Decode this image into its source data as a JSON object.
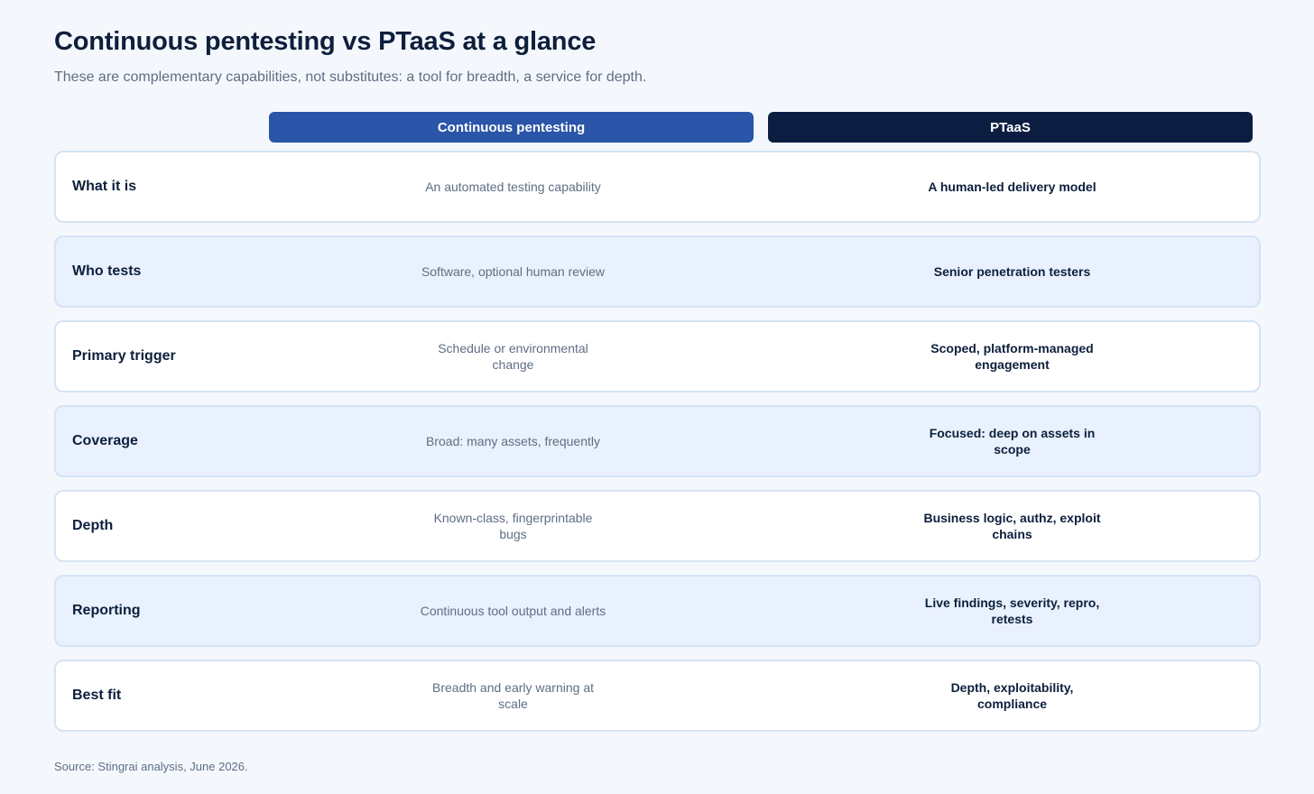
{
  "title": "Continuous pentesting vs PTaaS at a glance",
  "subtitle": "These are complementary capabilities, not substitutes: a tool for breadth, a service for depth.",
  "columns": {
    "continuous": "Continuous pentesting",
    "ptaas": "PTaaS"
  },
  "colors": {
    "continuous_header": "#2a55a8",
    "ptaas_header": "#0b1e42",
    "row_alt_background": "#e8f1fd",
    "page_background": "#f4f8fd"
  },
  "rows": [
    {
      "label": "What it is",
      "continuous": "An automated testing capability",
      "ptaas": "A human-led delivery model"
    },
    {
      "label": "Who tests",
      "continuous": "Software, optional human review",
      "ptaas": "Senior penetration testers"
    },
    {
      "label": "Primary trigger",
      "continuous": "Schedule or environmental change",
      "ptaas": "Scoped, platform-managed engagement"
    },
    {
      "label": "Coverage",
      "continuous": "Broad: many assets, frequently",
      "ptaas": "Focused: deep on assets in scope"
    },
    {
      "label": "Depth",
      "continuous": "Known-class, fingerprintable bugs",
      "ptaas": "Business logic, authz, exploit chains"
    },
    {
      "label": "Reporting",
      "continuous": "Continuous tool output and alerts",
      "ptaas": "Live findings, severity, repro, retests"
    },
    {
      "label": "Best fit",
      "continuous": "Breadth and early warning at scale",
      "ptaas": "Depth, exploitability, compliance"
    }
  ],
  "source": "Source: Stingrai analysis, June 2026."
}
